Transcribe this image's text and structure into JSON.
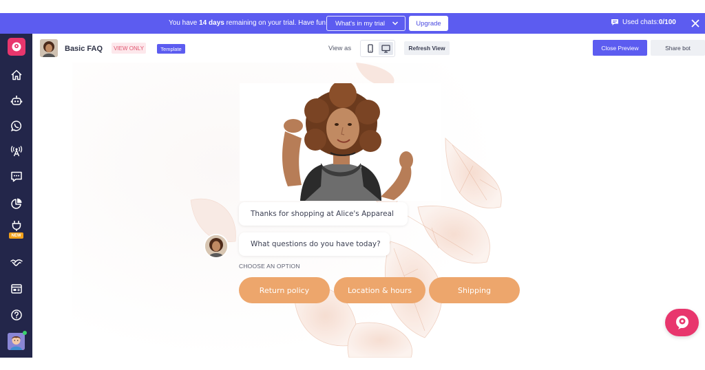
{
  "banner": {
    "message_prefix": "You have ",
    "message_days": "14 days",
    "message_suffix": " remaining on your trial. Have fun!",
    "trial_dropdown_label": "What's in my trial",
    "upgrade_label": "Upgrade",
    "used_chats_label": "Used chats: ",
    "used_chats_value": "0/100"
  },
  "header": {
    "bot_name": "Basic FAQ",
    "view_only_badge": "VIEW ONLY",
    "template_badge": "Template",
    "view_as_label": "View as",
    "refresh_label": "Refresh View",
    "close_preview_label": "Close Preview",
    "share_bot_label": "Share bot"
  },
  "sidebar": {
    "items": [
      {
        "icon": "home-icon"
      },
      {
        "icon": "bot-icon"
      },
      {
        "icon": "whatsapp-icon"
      },
      {
        "icon": "broadcast-icon"
      },
      {
        "icon": "chat-message-icon"
      },
      {
        "icon": "analytics-pie-icon"
      },
      {
        "icon": "integrations-plug-icon",
        "badge": "NEW"
      },
      {
        "icon": "handshake-icon"
      },
      {
        "icon": "template-card-icon"
      },
      {
        "icon": "help-icon"
      }
    ]
  },
  "chat": {
    "messages": [
      "Thanks for shopping at Alice's Appareal",
      "What questions do you have today?"
    ],
    "choose_label": "CHOOSE AN OPTION",
    "options": [
      "Return policy",
      "Location & hours",
      "Shipping"
    ]
  },
  "colors": {
    "brand_purple": "#5c5cf0",
    "sidebar_navy": "#23264a",
    "brand_pink": "#e8366d",
    "option_orange": "#eda66c"
  }
}
